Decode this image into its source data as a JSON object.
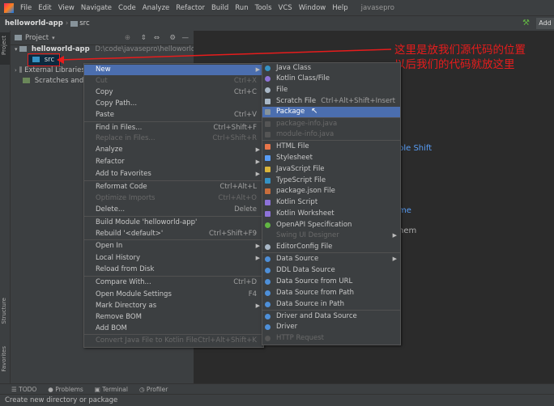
{
  "menubar": {
    "items": [
      "File",
      "Edit",
      "View",
      "Navigate",
      "Code",
      "Analyze",
      "Refactor",
      "Build",
      "Run",
      "Tools",
      "VCS",
      "Window",
      "Help"
    ],
    "project_name": "javasepro"
  },
  "navbar": {
    "project": "helloworld-app",
    "folder": "src",
    "add_label": "Add"
  },
  "sidebar": {
    "project_tab": "Project",
    "structure_tab": "Structure",
    "favorites_tab": "Favorites"
  },
  "project_panel": {
    "header": "Project",
    "root_label": "helloworld-app",
    "root_path": "D:\\code\\javasepro\\helloworld-app",
    "src_label": "src",
    "external_label": "External Libraries",
    "scratches_label": "Scratches and Co"
  },
  "context_menu": {
    "items": [
      {
        "label": "New",
        "shortcut": "",
        "arrow": true,
        "selected": true,
        "disabled": false
      },
      {
        "label": "Cut",
        "shortcut": "Ctrl+X",
        "disabled": true
      },
      {
        "label": "Copy",
        "shortcut": "Ctrl+C",
        "disabled": false
      },
      {
        "label": "Copy Path...",
        "shortcut": "",
        "disabled": false
      },
      {
        "label": "Paste",
        "shortcut": "Ctrl+V",
        "disabled": false
      },
      {
        "label": "Find in Files...",
        "shortcut": "Ctrl+Shift+F",
        "disabled": false
      },
      {
        "label": "Replace in Files...",
        "shortcut": "Ctrl+Shift+R",
        "disabled": true
      },
      {
        "label": "Analyze",
        "shortcut": "",
        "arrow": true,
        "disabled": false
      },
      {
        "label": "Refactor",
        "shortcut": "",
        "arrow": true,
        "disabled": false
      },
      {
        "label": "Add to Favorites",
        "shortcut": "",
        "arrow": true,
        "disabled": false
      },
      {
        "label": "Reformat Code",
        "shortcut": "Ctrl+Alt+L",
        "disabled": false
      },
      {
        "label": "Optimize Imports",
        "shortcut": "Ctrl+Alt+O",
        "disabled": true
      },
      {
        "label": "Delete...",
        "shortcut": "Delete",
        "disabled": false
      },
      {
        "label": "Build Module 'helloworld-app'",
        "shortcut": "",
        "disabled": false
      },
      {
        "label": "Rebuild '<default>'",
        "shortcut": "Ctrl+Shift+F9",
        "disabled": false
      },
      {
        "label": "Open In",
        "shortcut": "",
        "arrow": true,
        "disabled": false
      },
      {
        "label": "Local History",
        "shortcut": "",
        "arrow": true,
        "disabled": false
      },
      {
        "label": "Reload from Disk",
        "shortcut": "",
        "disabled": false
      },
      {
        "label": "Compare With...",
        "shortcut": "Ctrl+D",
        "disabled": false
      },
      {
        "label": "Open Module Settings",
        "shortcut": "F4",
        "disabled": false
      },
      {
        "label": "Mark Directory as",
        "shortcut": "",
        "arrow": true,
        "disabled": false
      },
      {
        "label": "Remove BOM",
        "shortcut": "",
        "disabled": false
      },
      {
        "label": "Add BOM",
        "shortcut": "",
        "disabled": false
      },
      {
        "label": "Convert Java File to Kotlin File",
        "shortcut": "Ctrl+Alt+Shift+K",
        "disabled": true
      }
    ]
  },
  "new_submenu": {
    "items": [
      {
        "label": "Java Class",
        "icon": "java-class-icon",
        "color": "#3592c4",
        "disabled": false
      },
      {
        "label": "Kotlin Class/File",
        "icon": "kotlin-icon",
        "color": "#8d72d8",
        "disabled": false
      },
      {
        "label": "File",
        "icon": "file-icon",
        "color": "#a9b7c6",
        "disabled": false
      },
      {
        "label": "Scratch File",
        "shortcut": "Ctrl+Alt+Shift+Insert",
        "icon": "scratch-icon",
        "color": "#a9b7c6",
        "disabled": false
      },
      {
        "label": "Package",
        "icon": "package-icon",
        "color": "#87939a",
        "disabled": false,
        "selected": true
      },
      {
        "label": "package-info.java",
        "icon": "java-file-icon",
        "color": "#555",
        "disabled": true
      },
      {
        "label": "module-info.java",
        "icon": "java-file-icon",
        "color": "#555",
        "disabled": true
      },
      {
        "label": "HTML File",
        "icon": "html-icon",
        "color": "#e8754a",
        "disabled": false
      },
      {
        "label": "Stylesheet",
        "icon": "css-icon",
        "color": "#589df6",
        "disabled": false
      },
      {
        "label": "JavaScript File",
        "icon": "js-icon",
        "color": "#d9b43a",
        "disabled": false
      },
      {
        "label": "TypeScript File",
        "icon": "ts-icon",
        "color": "#3592c4",
        "disabled": false
      },
      {
        "label": "package.json File",
        "icon": "json-icon",
        "color": "#c76d3c",
        "disabled": false
      },
      {
        "label": "Kotlin Script",
        "icon": "kotlin-script-icon",
        "color": "#8d72d8",
        "disabled": false
      },
      {
        "label": "Kotlin Worksheet",
        "icon": "kotlin-worksheet-icon",
        "color": "#8d72d8",
        "disabled": false
      },
      {
        "label": "OpenAPI Specification",
        "icon": "openapi-icon",
        "color": "#62b543",
        "disabled": false
      },
      {
        "label": "Swing UI Designer",
        "icon": "",
        "color": "",
        "disabled": true,
        "arrow": true
      },
      {
        "label": "EditorConfig File",
        "icon": "gear-icon",
        "color": "#a9b7c6",
        "disabled": false
      },
      {
        "label": "Data Source",
        "icon": "datasource-icon",
        "color": "#4e8fd8",
        "disabled": false,
        "arrow": true
      },
      {
        "label": "DDL Data Source",
        "icon": "ddl-icon",
        "color": "#4e8fd8",
        "disabled": false
      },
      {
        "label": "Data Source from URL",
        "icon": "url-icon",
        "color": "#4e8fd8",
        "disabled": false
      },
      {
        "label": "Data Source from Path",
        "icon": "path-icon",
        "color": "#4e8fd8",
        "disabled": false
      },
      {
        "label": "Data Source in Path",
        "icon": "path-icon",
        "color": "#4e8fd8",
        "disabled": false
      },
      {
        "label": "Driver and Data Source",
        "icon": "driver-icon",
        "color": "#4e8fd8",
        "disabled": false
      },
      {
        "label": "Driver",
        "icon": "driver-icon",
        "color": "#4e8fd8",
        "disabled": false
      },
      {
        "label": "HTTP Request",
        "icon": "http-icon",
        "color": "#555",
        "disabled": true
      }
    ]
  },
  "editor": {
    "hint1": "ble Shift",
    "hint2": "me",
    "hint3": "hem"
  },
  "annotation": {
    "line1": "这里是放我们源代码的位置",
    "line2": "以后我们的代码就放这里"
  },
  "bottom": {
    "todo": "TODO",
    "problems": "Problems",
    "terminal": "Terminal",
    "profiler": "Profiler"
  },
  "status": {
    "text": "Create new directory or package"
  }
}
